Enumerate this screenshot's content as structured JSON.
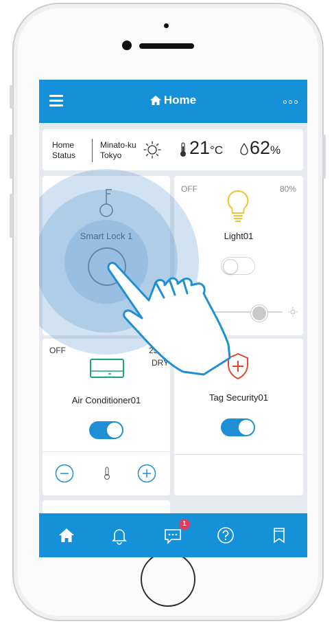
{
  "header": {
    "title": "Home"
  },
  "status": {
    "label_line1": "Home",
    "label_line2": "Status",
    "location_line1": "Minato-ku",
    "location_line2": "Tokyo",
    "temperature": "21",
    "temperature_unit": "°C",
    "humidity": "62",
    "humidity_unit": "%",
    "weather_icon": "sun-icon"
  },
  "devices": {
    "lock": {
      "name": "Smart Lock 1",
      "icon": "key-icon"
    },
    "light": {
      "name": "Light01",
      "state": "OFF",
      "brightness": "80%",
      "on": false,
      "icon": "bulb-icon"
    },
    "aircon": {
      "name": "Air Conditioner01",
      "state": "OFF",
      "temp_partial": "25",
      "mode": "DRY",
      "on": true,
      "icon": "aircon-icon"
    },
    "security": {
      "name": "Tag Security01",
      "on": true,
      "icon": "shield-plus-icon"
    }
  },
  "nav": {
    "items": [
      "home-icon",
      "bell-icon",
      "chat-icon",
      "help-icon",
      "bookmark-icon"
    ],
    "chat_badge": "1"
  },
  "colors": {
    "accent": "#1491d8",
    "toggle_on": "#1e8fd4",
    "security_red": "#e8442c",
    "aircon_green": "#1aa47d",
    "bulb_yellow": "#f2c230"
  }
}
